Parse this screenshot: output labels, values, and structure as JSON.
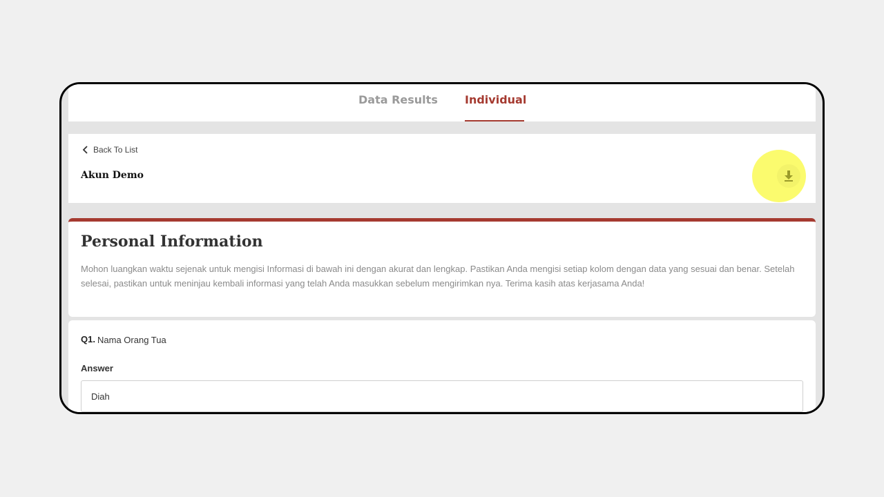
{
  "tabs": [
    {
      "label": "Data Results"
    },
    {
      "label": "Individual"
    }
  ],
  "header": {
    "back_label": "Back To List",
    "account_name": "Akun Demo",
    "download_icon": "download-icon"
  },
  "personal_info": {
    "title": "Personal Information",
    "description": "Mohon luangkan waktu sejenak untuk mengisi Informasi di bawah ini dengan akurat dan lengkap. Pastikan Anda mengisi setiap kolom dengan data yang sesuai dan benar. Setelah selesai, pastikan untuk meninjau kembali informasi yang telah Anda masukkan sebelum mengirimkan nya. Terima kasih atas kerjasama Anda!"
  },
  "question": {
    "number": "Q1.",
    "text": "Nama Orang Tua",
    "answer_label": "Answer",
    "answer_value": "Diah"
  },
  "colors": {
    "accent": "#a53a30",
    "highlight": "#fbfb6e"
  }
}
